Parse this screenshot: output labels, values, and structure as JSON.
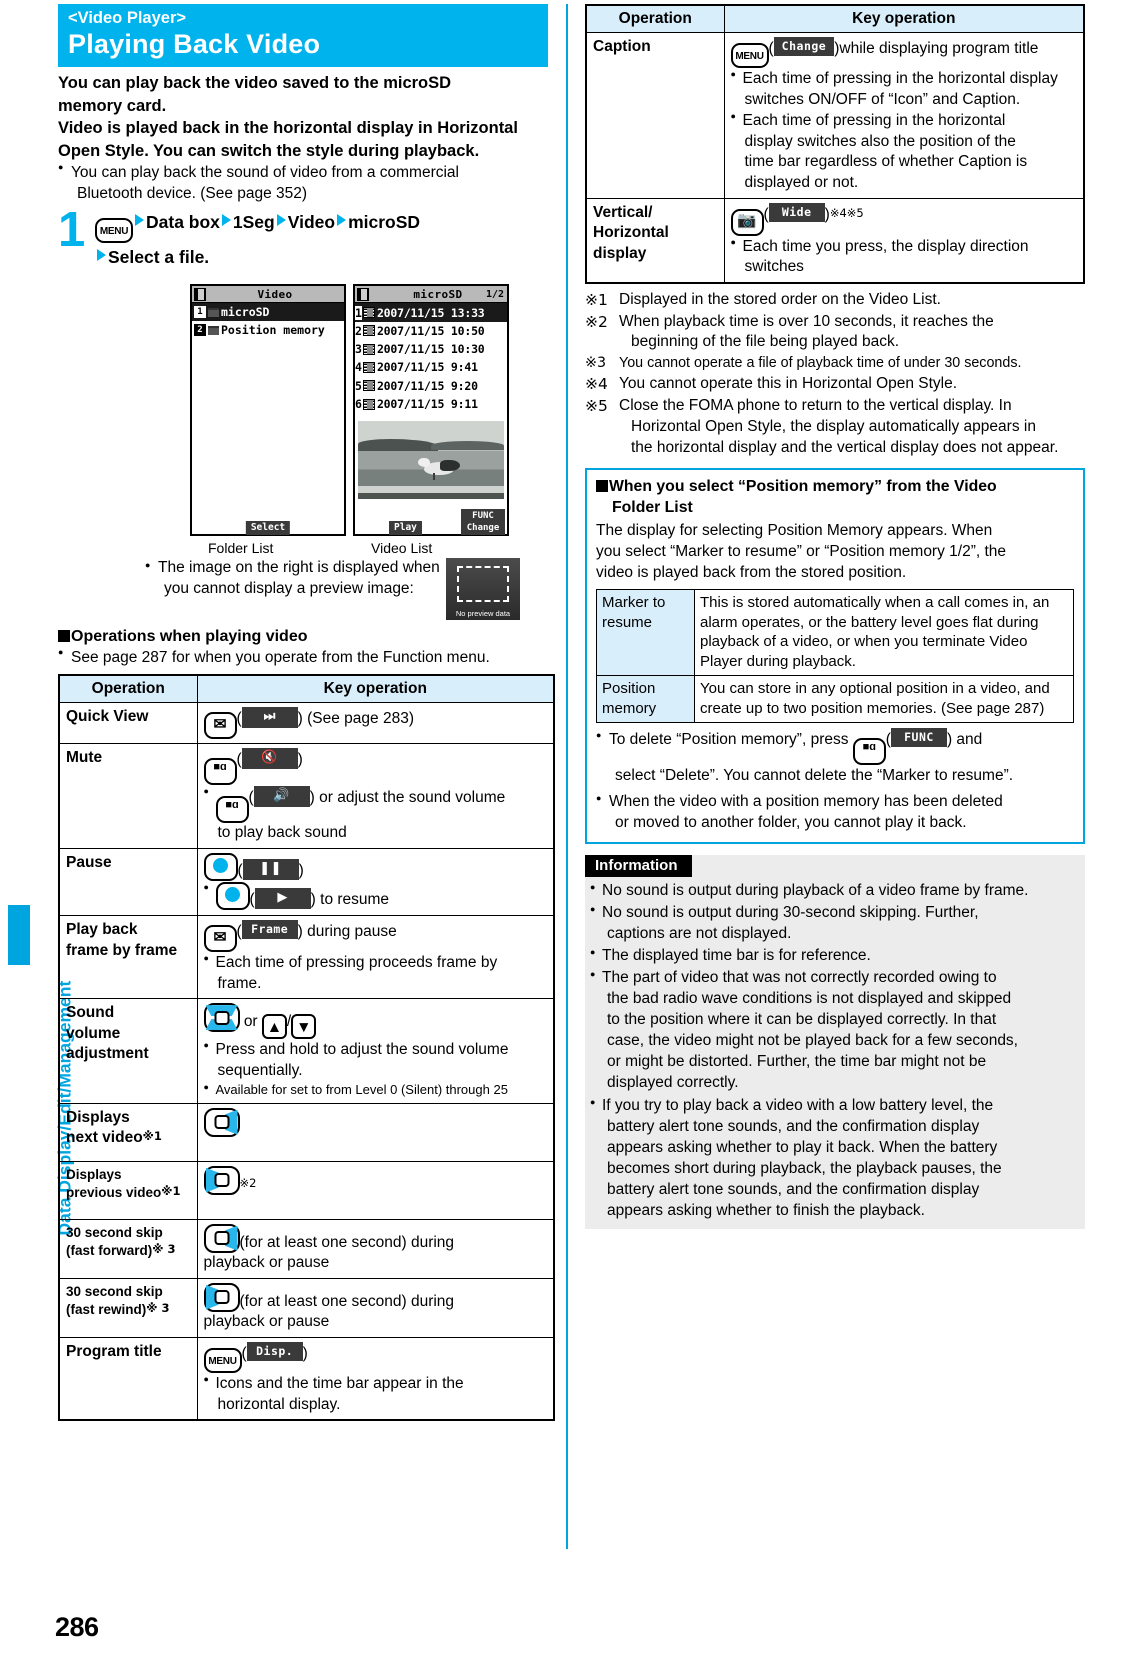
{
  "colors": {
    "accent": "#00b3ec",
    "banner": "#00b3ec",
    "table_header": "#d9eefb",
    "info_bg": "#ececec"
  },
  "side_tab": {
    "label": "Data Display/Edit/Management"
  },
  "page_number": "286",
  "header": {
    "subtitle": "<Video Player>",
    "title": "Playing Back Video"
  },
  "intro": {
    "lead_1": "You can play back the video saved to the microSD",
    "lead_2": "memory card.",
    "lead_3": "Video is played back in the horizontal display in Horizontal",
    "lead_4": "Open Style. You can switch the style during playback.",
    "bullet_1a": "You can play back the sound of video from a commercial",
    "bullet_1b": "Bluetooth device. (See page 352)"
  },
  "step": {
    "number": "1",
    "key_label": "MENU",
    "items": [
      "Data box",
      "1Seg",
      "Video",
      "microSD"
    ],
    "line2": "Select a file."
  },
  "screens": {
    "folder_list": {
      "caption": "Folder List",
      "title": "Video",
      "rows": [
        {
          "no": "1",
          "label": "microSD",
          "selected": true
        },
        {
          "no": "2",
          "label": "Position memory",
          "selected": false
        }
      ],
      "softkey": "Select"
    },
    "video_list": {
      "caption": "Video List",
      "title": "microSD",
      "page": "1/2",
      "rows": [
        {
          "no": "1",
          "label": "2007/11/15 13:33",
          "selected": true
        },
        {
          "no": "2",
          "label": "2007/11/15 10:50",
          "selected": false
        },
        {
          "no": "3",
          "label": "2007/11/15 10:30",
          "selected": false
        },
        {
          "no": "4",
          "label": "2007/11/15  9:41",
          "selected": false
        },
        {
          "no": "5",
          "label": "2007/11/15  9:20",
          "selected": false
        },
        {
          "no": "6",
          "label": "2007/11/15  9:11",
          "selected": false
        }
      ],
      "softkey_center": "Play",
      "softkey_right_1": "FUNC",
      "softkey_right_2": "Change"
    }
  },
  "no_preview": {
    "text_1": "The image on the right is displayed when",
    "text_2": "you cannot display a preview image:",
    "thumb_label": "No preview data"
  },
  "operations_section": {
    "heading": "Operations when playing video",
    "note": "See page 287 for when you operate from the Function menu."
  },
  "table_left": {
    "col_operation": "Operation",
    "col_key": "Key operation",
    "rows": [
      {
        "operation": "Quick View",
        "key_icon": "mail-key",
        "chip": "⏭",
        "after": ") (See page 283)",
        "lines": []
      },
      {
        "operation": "Mute",
        "key_icon": "imode-key",
        "chip": "✇",
        "after": ")",
        "lines": [
          {
            "icon": "imode-key",
            "chip": "ὐA",
            "text": ") or adjust the sound volume",
            "text2": "to play back sound"
          }
        ]
      },
      {
        "operation": "Pause",
        "key_icon": "center-key",
        "chip": "❙❙",
        "after": ")",
        "lines": [
          {
            "icon": "center-key",
            "chip": "▶",
            "text": ") to resume",
            "text2": ""
          }
        ]
      },
      {
        "operation_1": "Play back",
        "operation_2": "frame by frame",
        "key_icon": "mail-key",
        "chip": "Frame",
        "after": ") during pause",
        "lines": [
          {
            "text": "Each time of pressing proceeds frame by",
            "text2": "frame."
          }
        ]
      },
      {
        "operation_1": "Sound",
        "operation_2": "volume",
        "operation_3": "adjustment",
        "keys": "updown-center-or-side",
        "or_text": "or",
        "lines": [
          {
            "text": "Press and hold to adjust the sound volume",
            "text2": "sequentially."
          },
          {
            "text": "Available for set to from Level 0 (Silent) through 25",
            "small": true
          }
        ]
      },
      {
        "operation_1": "Displays",
        "operation_2": "next video",
        "ref": "※1",
        "key": "right-key"
      },
      {
        "operation_1": "Displays",
        "operation_2": "previous video",
        "ref": "※1",
        "key": "left-key",
        "suffix": "※2",
        "small_op": true
      },
      {
        "operation_1": "30 second skip",
        "operation_2": "(fast forward)",
        "ref": "※ 3",
        "key": "right-key",
        "text": "(for at least one second) during",
        "text2": "playback or pause",
        "small_op": true
      },
      {
        "operation_1": "30 second skip",
        "operation_2": "(fast rewind)",
        "ref": "※ 3",
        "key": "left-key",
        "text": "(for at least one second) during",
        "text2": "playback or pause",
        "small_op": true
      },
      {
        "operation": "Program title",
        "key_icon": "menu-key",
        "chip": "Disp.",
        "after": ")",
        "lines": [
          {
            "text": "Icons and the time bar appear in the",
            "text2": "horizontal display."
          }
        ]
      }
    ]
  },
  "table_right": {
    "col_operation": "Operation",
    "col_key": "Key operation",
    "rows": [
      {
        "operation": "Caption",
        "key_icon": "menu-key",
        "chip": "Change",
        "after": ")while displaying program title",
        "lines": [
          {
            "text": "Each time of pressing in the horizontal display",
            "text2": "switches ON/OFF of “Icon” and Caption."
          },
          {
            "text": "Each time of pressing in the horizontal",
            "text2": "display switches also the position of the",
            "text3": "time bar regardless of whether Caption is",
            "text4": "displayed or not."
          }
        ]
      },
      {
        "operation_1": "Vertical/",
        "operation_2": "Horizontal",
        "operation_3": "display",
        "key_icon": "camera-key",
        "chip": "Wide",
        "after": ")",
        "suffix": "※4※5",
        "lines": [
          {
            "text": "Each time you press, the display direction",
            "text2": "switches"
          }
        ]
      }
    ]
  },
  "footnotes": [
    {
      "mark": "※1",
      "lines": [
        "Displayed in the stored order on the Video List."
      ]
    },
    {
      "mark": "※2",
      "lines": [
        "When playback time is over 10 seconds, it reaches the",
        "beginning of the file being played back."
      ]
    },
    {
      "mark": "※3",
      "small": true,
      "lines": [
        "You cannot operate a file of playback time of under 30 seconds."
      ]
    },
    {
      "mark": "※4",
      "lines": [
        "You cannot operate this in Horizontal Open Style."
      ]
    },
    {
      "mark": "※5",
      "lines": [
        "Close the FOMA phone to return to the vertical display. In",
        "Horizontal Open Style, the display automatically appears in",
        "the horizontal display and the vertical display does not appear."
      ]
    }
  ],
  "position_box": {
    "heading_1": "When you select “Position memory” from the Video",
    "heading_2": "Folder List",
    "desc_1": "The display for selecting Position Memory appears. When",
    "desc_2": "you select “Marker to resume” or “Position memory 1/2”, the",
    "desc_3": "video is played back from the stored position.",
    "rows": [
      {
        "key_1": "Marker to",
        "key_2": "resume",
        "value": "This is stored automatically when a call comes in, an alarm operates, or the battery level goes flat during playback of a video, or when you terminate Video Player during playback."
      },
      {
        "key_1": "Position",
        "key_2": "memory",
        "value": "You can store in any optional position in a video, and create up to two position memories. (See page 287)"
      }
    ],
    "bullets": [
      {
        "pre": "To delete “Position memory”, press ",
        "icon": "imode-key",
        "chip": "FUNC",
        "post": ") and",
        "line2": "select “Delete”. You cannot delete the “Marker to resume”."
      },
      {
        "pre": "When the video with a position memory has been deleted",
        "line2": "or moved to another folder, you cannot play it back."
      }
    ]
  },
  "information": {
    "tag": "Information",
    "items": [
      [
        "No sound is output during playback of a video frame by frame."
      ],
      [
        "No sound is output during 30-second skipping. Further,",
        "captions are not displayed."
      ],
      [
        "The displayed time bar is for reference."
      ],
      [
        "The part of video that was not correctly recorded owing to",
        "the bad radio wave conditions is not displayed and skipped",
        "to the position where it can be displayed correctly. In that",
        "case, the video might not be played back for a few seconds,",
        "or might be distorted. Further, the time bar might not be",
        "displayed correctly."
      ],
      [
        "If you try to play back a video with a low battery level, the",
        "battery alert tone sounds, and the confirmation display",
        "appears asking whether to play it back. When the battery",
        "becomes short during playback, the playback pauses, the",
        "battery alert tone sounds, and the confirmation display",
        "appears asking whether to finish the playback."
      ]
    ]
  }
}
